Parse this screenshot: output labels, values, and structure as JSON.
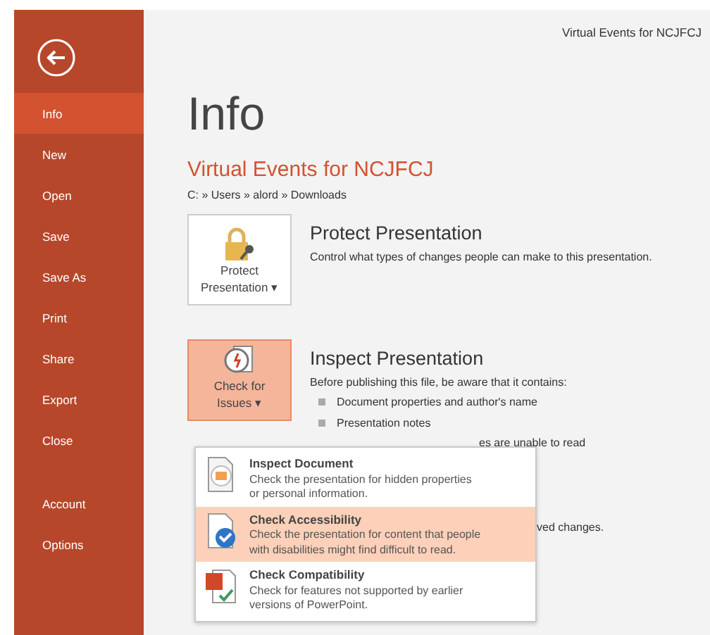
{
  "document_title": "Virtual Events for NCJFCJ",
  "sidebar": {
    "items": [
      {
        "label": "Info",
        "selected": true
      },
      {
        "label": "New",
        "selected": false
      },
      {
        "label": "Open",
        "selected": false
      },
      {
        "label": "Save",
        "selected": false
      },
      {
        "label": "Save As",
        "selected": false
      },
      {
        "label": "Print",
        "selected": false
      },
      {
        "label": "Share",
        "selected": false
      },
      {
        "label": "Export",
        "selected": false
      },
      {
        "label": "Close",
        "selected": false
      }
    ],
    "bottom_items": [
      {
        "label": "Account",
        "selected": false
      },
      {
        "label": "Options",
        "selected": false
      }
    ]
  },
  "page_title": "Info",
  "file_name": "Virtual Events for NCJFCJ",
  "file_path": "C: » Users » alord » Downloads",
  "sections": [
    {
      "kind": "protect",
      "button_label": [
        "Protect",
        "Presentation ▾"
      ],
      "highlighted": false,
      "title": "Protect Presentation",
      "description": "Control what types of changes people can make to this presentation."
    },
    {
      "kind": "inspect",
      "button_label": [
        "Check for",
        "Issues ▾"
      ],
      "highlighted": true,
      "title": "Inspect Presentation",
      "description": "Before publishing this file, be aware that it contains:",
      "bullets": [
        "Document properties and author's name",
        "Presentation notes"
      ]
    }
  ],
  "obscured_fragments": [
    "es are unable to read",
    "ved changes."
  ],
  "menu": {
    "items": [
      {
        "kind": "inspect",
        "title": "Inspect Document",
        "description": [
          "Check the presentation for hidden properties",
          "or personal information."
        ],
        "selected": false
      },
      {
        "kind": "accessibility",
        "title": "Check Accessibility",
        "description": [
          "Check the presentation for content that people",
          "with disabilities might find difficult to read."
        ],
        "selected": true
      },
      {
        "kind": "compatibility",
        "title": "Check Compatibility",
        "description": [
          "Check for features not supported by earlier",
          "versions of PowerPoint."
        ],
        "selected": false
      }
    ]
  }
}
